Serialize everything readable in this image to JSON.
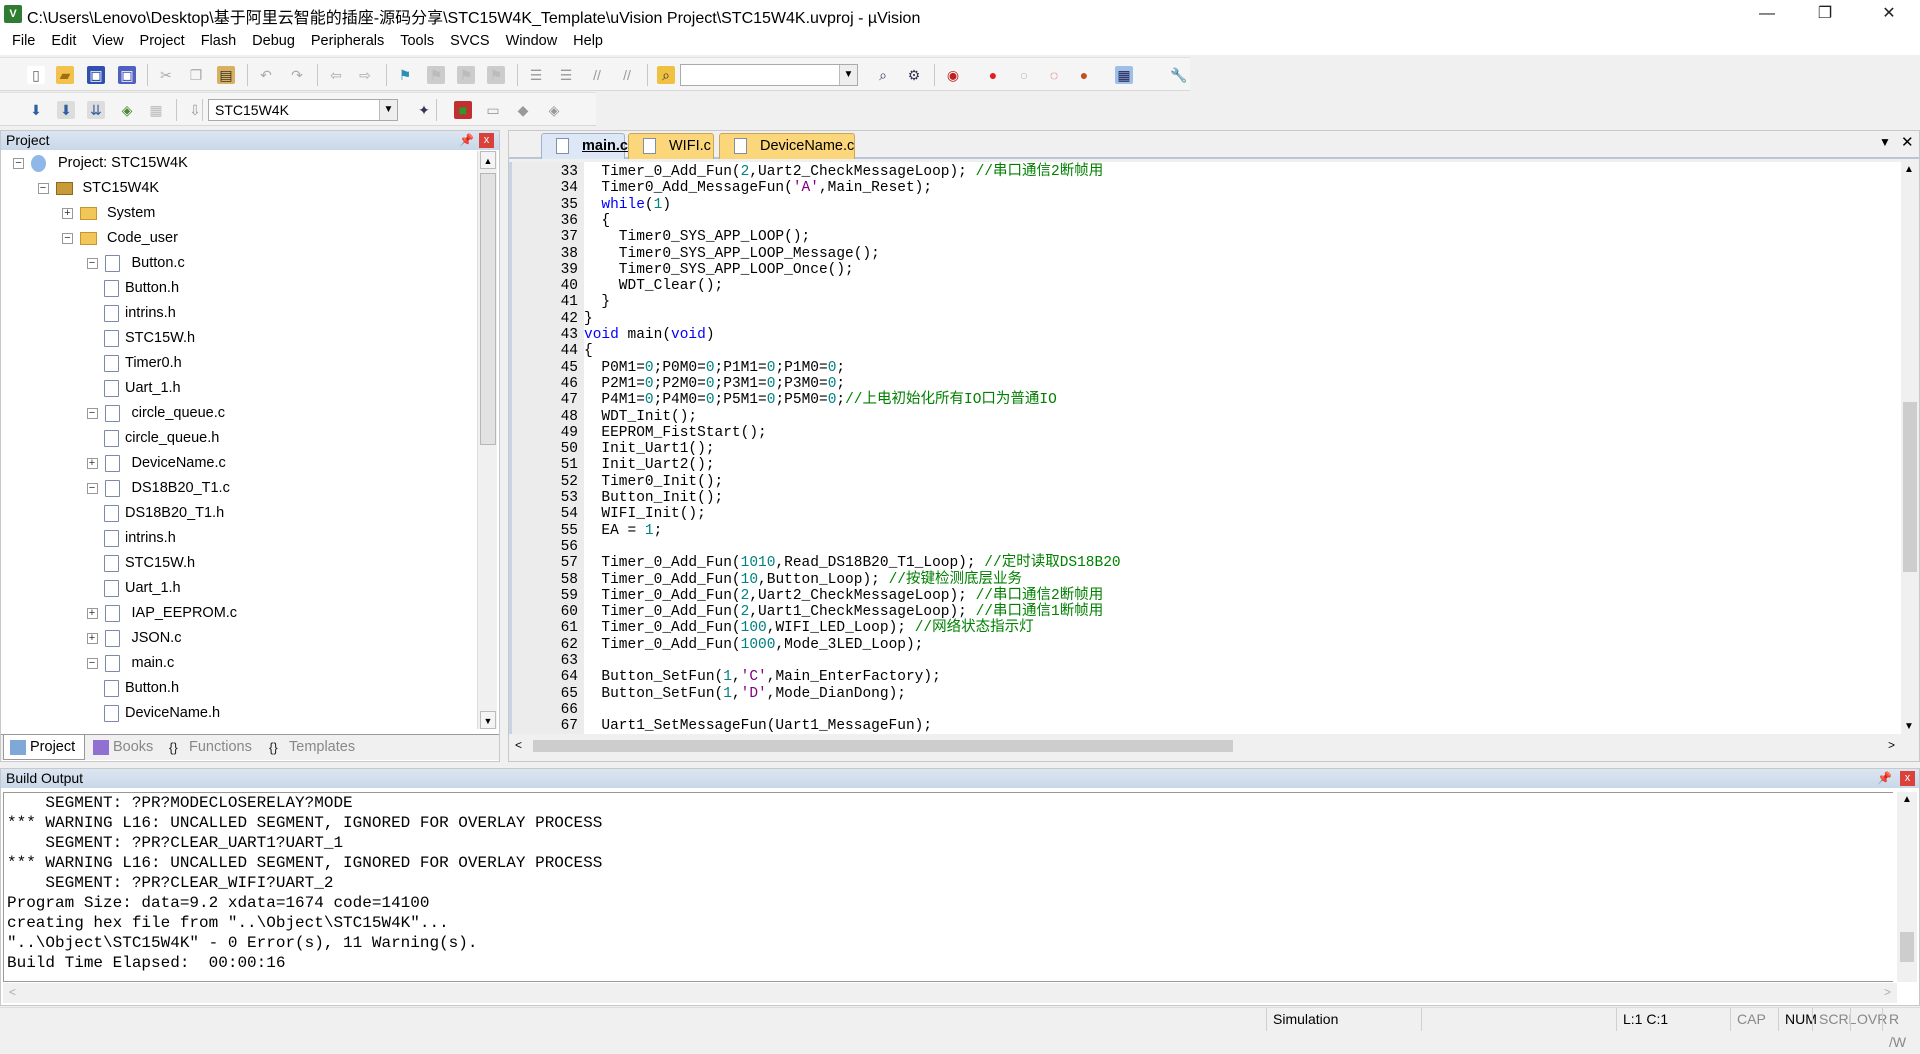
{
  "window": {
    "title": "C:\\Users\\Lenovo\\Desktop\\基于阿里云智能的插座-源码分享\\STC15W4K_Template\\uVision Project\\STC15W4K.uvproj - µVision",
    "minimize": "—",
    "restore": "❐",
    "close": "✕"
  },
  "menu": [
    "File",
    "Edit",
    "View",
    "Project",
    "Flash",
    "Debug",
    "Peripherals",
    "Tools",
    "SVCS",
    "Window",
    "Help"
  ],
  "toolbar1": {
    "icons": [
      "new-file-icon",
      "open-folder-icon",
      "save-icon",
      "save-all-icon",
      "cut-icon",
      "copy-icon",
      "paste-icon",
      "undo-icon",
      "redo-icon",
      "navigate-back-icon",
      "navigate-forward-icon",
      "bookmark-icon",
      "prev-bookmark-icon",
      "next-bookmark-icon",
      "clear-bookmarks-icon",
      "indent-icon",
      "unindent-icon",
      "comment-icon",
      "uncomment-icon",
      "find-in-files-icon",
      "find-icon",
      "incremental-find-icon",
      "debug-session-icon",
      "breakpoint-icon",
      "disable-breakpoint-icon",
      "disable-all-breakpoints-icon",
      "kill-breakpoints-icon",
      "window-layout-icon",
      "configure-icon"
    ]
  },
  "toolbar2": {
    "icons": [
      "translate-icon",
      "build-icon",
      "rebuild-icon",
      "batch-build-icon",
      "stop-build-icon",
      "download-icon",
      "target-options-icon",
      "manage-components-icon",
      "select-packs-icon",
      "pack-installer-icon",
      "run-time-env-icon"
    ],
    "target": "STC15W4K"
  },
  "project_panel": {
    "title": "Project",
    "tree": [
      {
        "label": "Project: STC15W4K",
        "depth": 0,
        "icon": "project-icon",
        "expand": "minus"
      },
      {
        "label": "STC15W4K",
        "depth": 1,
        "icon": "target-icon",
        "expand": "minus"
      },
      {
        "label": "System",
        "depth": 2,
        "icon": "folder-icon",
        "expand": "plus"
      },
      {
        "label": "Code_user",
        "depth": 2,
        "icon": "folder-icon",
        "expand": "minus"
      },
      {
        "label": "Button.c",
        "depth": 3,
        "icon": "file-icon",
        "expand": "minus"
      },
      {
        "label": "Button.h",
        "depth": 4,
        "icon": "file-icon",
        "expand": ""
      },
      {
        "label": "intrins.h",
        "depth": 4,
        "icon": "file-icon",
        "expand": ""
      },
      {
        "label": "STC15W.h",
        "depth": 4,
        "icon": "file-icon",
        "expand": ""
      },
      {
        "label": "Timer0.h",
        "depth": 4,
        "icon": "file-icon",
        "expand": ""
      },
      {
        "label": "Uart_1.h",
        "depth": 4,
        "icon": "file-icon",
        "expand": ""
      },
      {
        "label": "circle_queue.c",
        "depth": 3,
        "icon": "file-icon",
        "expand": "minus"
      },
      {
        "label": "circle_queue.h",
        "depth": 4,
        "icon": "file-icon",
        "expand": ""
      },
      {
        "label": "DeviceName.c",
        "depth": 3,
        "icon": "file-icon",
        "expand": "plus"
      },
      {
        "label": "DS18B20_T1.c",
        "depth": 3,
        "icon": "file-icon",
        "expand": "minus"
      },
      {
        "label": "DS18B20_T1.h",
        "depth": 4,
        "icon": "file-icon",
        "expand": ""
      },
      {
        "label": "intrins.h",
        "depth": 4,
        "icon": "file-icon",
        "expand": ""
      },
      {
        "label": "STC15W.h",
        "depth": 4,
        "icon": "file-icon",
        "expand": ""
      },
      {
        "label": "Uart_1.h",
        "depth": 4,
        "icon": "file-icon",
        "expand": ""
      },
      {
        "label": "IAP_EEPROM.c",
        "depth": 3,
        "icon": "file-icon",
        "expand": "plus"
      },
      {
        "label": "JSON.c",
        "depth": 3,
        "icon": "file-icon",
        "expand": "plus"
      },
      {
        "label": "main.c",
        "depth": 3,
        "icon": "file-icon",
        "expand": "minus"
      },
      {
        "label": "Button.h",
        "depth": 4,
        "icon": "file-icon",
        "expand": ""
      },
      {
        "label": "DeviceName.h",
        "depth": 4,
        "icon": "file-icon",
        "expand": ""
      }
    ],
    "tabs": [
      {
        "label": "Project",
        "active": true
      },
      {
        "label": "Books"
      },
      {
        "label": "Functions"
      },
      {
        "label": "Templates"
      }
    ]
  },
  "editor": {
    "tabs": [
      {
        "label": "main.c",
        "active": true
      },
      {
        "label": "WIFI.c"
      },
      {
        "label": "DeviceName.c"
      }
    ],
    "colors": {
      "keyword": "#0000ff",
      "number": "#008080",
      "comment": "#008000",
      "char": "#800080"
    },
    "lines": [
      {
        "n": "33",
        "s": [
          [
            "  Timer_0_Add_Fun(",
            ""
          ],
          [
            "2",
            "num"
          ],
          [
            ",Uart2_CheckMessageLoop); ",
            ""
          ],
          [
            "//串口通信2断帧用",
            "cmt"
          ]
        ]
      },
      {
        "n": "34",
        "s": [
          [
            "  Timer0_Add_MessageFun(",
            ""
          ],
          [
            "'A'",
            "chr"
          ],
          [
            ",Main_Reset);",
            ""
          ]
        ]
      },
      {
        "n": "35",
        "s": [
          [
            "  ",
            ""
          ],
          [
            "while",
            "kw"
          ],
          [
            "(",
            ""
          ],
          [
            "1",
            "num"
          ],
          [
            ")",
            ""
          ]
        ]
      },
      {
        "n": "36",
        "s": [
          [
            "  {",
            ""
          ]
        ]
      },
      {
        "n": "37",
        "s": [
          [
            "    Timer0_SYS_APP_LOOP();",
            ""
          ]
        ]
      },
      {
        "n": "38",
        "s": [
          [
            "    Timer0_SYS_APP_LOOP_Message();",
            ""
          ]
        ]
      },
      {
        "n": "39",
        "s": [
          [
            "    Timer0_SYS_APP_LOOP_Once();",
            ""
          ]
        ]
      },
      {
        "n": "40",
        "s": [
          [
            "    WDT_Clear();",
            ""
          ]
        ]
      },
      {
        "n": "41",
        "s": [
          [
            "  }",
            ""
          ]
        ]
      },
      {
        "n": "42",
        "s": [
          [
            "}",
            ""
          ]
        ]
      },
      {
        "n": "43",
        "s": [
          [
            "void",
            "kw"
          ],
          [
            " main(",
            ""
          ],
          [
            "void",
            "kw"
          ],
          [
            ")",
            ""
          ]
        ]
      },
      {
        "n": "44",
        "s": [
          [
            "{",
            ""
          ]
        ]
      },
      {
        "n": "45",
        "s": [
          [
            "  P0M1=",
            ""
          ],
          [
            "0",
            "num"
          ],
          [
            ";P0M0=",
            ""
          ],
          [
            "0",
            "num"
          ],
          [
            ";P1M1=",
            ""
          ],
          [
            "0",
            "num"
          ],
          [
            ";P1M0=",
            ""
          ],
          [
            "0",
            "num"
          ],
          [
            ";",
            ""
          ]
        ]
      },
      {
        "n": "46",
        "s": [
          [
            "  P2M1=",
            ""
          ],
          [
            "0",
            "num"
          ],
          [
            ";P2M0=",
            ""
          ],
          [
            "0",
            "num"
          ],
          [
            ";P3M1=",
            ""
          ],
          [
            "0",
            "num"
          ],
          [
            ";P3M0=",
            ""
          ],
          [
            "0",
            "num"
          ],
          [
            ";",
            ""
          ]
        ]
      },
      {
        "n": "47",
        "s": [
          [
            "  P4M1=",
            ""
          ],
          [
            "0",
            "num"
          ],
          [
            ";P4M0=",
            ""
          ],
          [
            "0",
            "num"
          ],
          [
            ";P5M1=",
            ""
          ],
          [
            "0",
            "num"
          ],
          [
            ";P5M0=",
            ""
          ],
          [
            "0",
            "num"
          ],
          [
            ";",
            ""
          ],
          [
            "//上电初始化所有IO口为普通IO",
            "cmt"
          ]
        ]
      },
      {
        "n": "48",
        "s": [
          [
            "  WDT_Init();",
            ""
          ]
        ]
      },
      {
        "n": "49",
        "s": [
          [
            "  EEPROM_FistStart();",
            ""
          ]
        ]
      },
      {
        "n": "50",
        "s": [
          [
            "  Init_Uart1();",
            ""
          ]
        ]
      },
      {
        "n": "51",
        "s": [
          [
            "  Init_Uart2();",
            ""
          ]
        ]
      },
      {
        "n": "52",
        "s": [
          [
            "  Timer0_Init();",
            ""
          ]
        ]
      },
      {
        "n": "53",
        "s": [
          [
            "  Button_Init();",
            ""
          ]
        ]
      },
      {
        "n": "54",
        "s": [
          [
            "  WIFI_Init();",
            ""
          ]
        ]
      },
      {
        "n": "55",
        "s": [
          [
            "  EA = ",
            ""
          ],
          [
            "1",
            "num"
          ],
          [
            ";",
            ""
          ]
        ]
      },
      {
        "n": "56",
        "s": []
      },
      {
        "n": "57",
        "s": [
          [
            "  Timer_0_Add_Fun(",
            ""
          ],
          [
            "1010",
            "num"
          ],
          [
            ",Read_DS18B20_T1_Loop); ",
            ""
          ],
          [
            "//定时读取DS18B20",
            "cmt"
          ]
        ]
      },
      {
        "n": "58",
        "s": [
          [
            "  Timer_0_Add_Fun(",
            ""
          ],
          [
            "10",
            "num"
          ],
          [
            ",Button_Loop); ",
            ""
          ],
          [
            "//按键检测底层业务",
            "cmt"
          ]
        ]
      },
      {
        "n": "59",
        "s": [
          [
            "  Timer_0_Add_Fun(",
            ""
          ],
          [
            "2",
            "num"
          ],
          [
            ",Uart2_CheckMessageLoop); ",
            ""
          ],
          [
            "//串口通信2断帧用",
            "cmt"
          ]
        ]
      },
      {
        "n": "60",
        "s": [
          [
            "  Timer_0_Add_Fun(",
            ""
          ],
          [
            "2",
            "num"
          ],
          [
            ",Uart1_CheckMessageLoop); ",
            ""
          ],
          [
            "//串口通信1断帧用",
            "cmt"
          ]
        ]
      },
      {
        "n": "61",
        "s": [
          [
            "  Timer_0_Add_Fun(",
            ""
          ],
          [
            "100",
            "num"
          ],
          [
            ",WIFI_LED_Loop); ",
            ""
          ],
          [
            "//网络状态指示灯",
            "cmt"
          ]
        ]
      },
      {
        "n": "62",
        "s": [
          [
            "  Timer_0_Add_Fun(",
            ""
          ],
          [
            "1000",
            "num"
          ],
          [
            ",Mode_3LED_Loop);",
            ""
          ]
        ]
      },
      {
        "n": "63",
        "s": []
      },
      {
        "n": "64",
        "s": [
          [
            "  Button_SetFun(",
            ""
          ],
          [
            "1",
            "num"
          ],
          [
            ",",
            ""
          ],
          [
            "'C'",
            "chr"
          ],
          [
            ",Main_EnterFactory);",
            ""
          ]
        ]
      },
      {
        "n": "65",
        "s": [
          [
            "  Button_SetFun(",
            ""
          ],
          [
            "1",
            "num"
          ],
          [
            ",",
            ""
          ],
          [
            "'D'",
            "chr"
          ],
          [
            ",Mode_DianDong);",
            ""
          ]
        ]
      },
      {
        "n": "66",
        "s": []
      },
      {
        "n": "67",
        "s": [
          [
            "  Uart1_SetMessageFun(Uart1_MessageFun);",
            ""
          ]
        ]
      }
    ]
  },
  "build_output": {
    "title": "Build Output",
    "lines": [
      "    SEGMENT: ?PR?MODECLOSERELAY?MODE",
      "*** WARNING L16: UNCALLED SEGMENT, IGNORED FOR OVERLAY PROCESS",
      "    SEGMENT: ?PR?CLEAR_UART1?UART_1",
      "*** WARNING L16: UNCALLED SEGMENT, IGNORED FOR OVERLAY PROCESS",
      "    SEGMENT: ?PR?CLEAR_WIFI?UART_2",
      "Program Size: data=9.2 xdata=1674 code=14100",
      "creating hex file from \"..\\Object\\STC15W4K\"...",
      "\"..\\Object\\STC15W4K\" - 0 Error(s), 11 Warning(s).",
      "Build Time Elapsed:  00:00:16"
    ]
  },
  "status": {
    "mode": "Simulation",
    "position": "L:1 C:1",
    "cap": "CAP",
    "num": "NUM",
    "scrl": "SCRL",
    "ovr": "OVR",
    "rw": "R /W"
  }
}
